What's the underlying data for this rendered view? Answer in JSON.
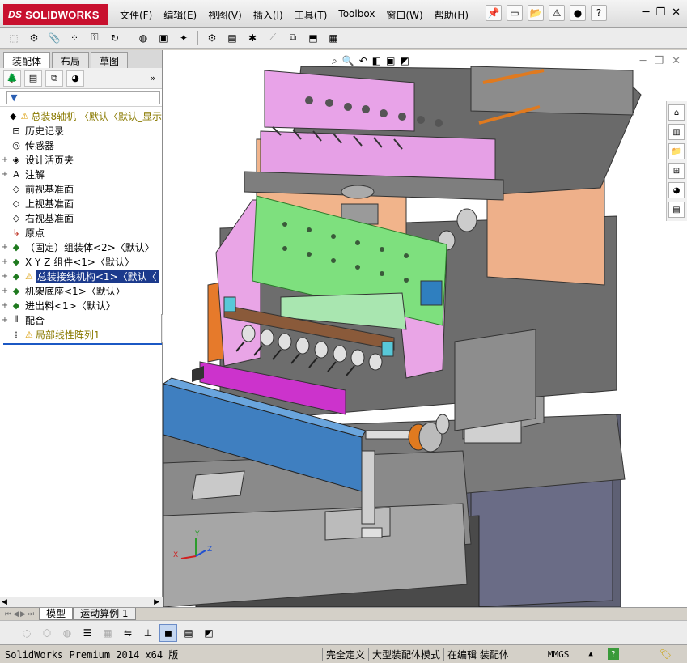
{
  "app": {
    "logo_prefix": "DS",
    "logo_text": "SOLIDWORKS"
  },
  "menu": [
    "文件(F)",
    "编辑(E)",
    "视图(V)",
    "插入(I)",
    "工具(T)",
    "Toolbox",
    "窗口(W)",
    "帮助(H)"
  ],
  "panel": {
    "tabs": [
      "装配体",
      "布局",
      "草图"
    ],
    "active_tab": "装配体",
    "filter_icon": "funnel-icon"
  },
  "tree": [
    {
      "label": "总装8轴机  〈默认〈默认_显示",
      "icon": "assembly-icon",
      "warn": true,
      "style": "olive",
      "expander": ""
    },
    {
      "label": "历史记录",
      "icon": "history-icon",
      "warn": false,
      "style": "",
      "expander": ""
    },
    {
      "label": "传感器",
      "icon": "sensor-icon",
      "warn": false,
      "style": "",
      "expander": ""
    },
    {
      "label": "设计活页夹",
      "icon": "binder-icon",
      "warn": false,
      "style": "",
      "expander": "+"
    },
    {
      "label": "注解",
      "icon": "annotation-icon",
      "warn": false,
      "style": "",
      "expander": "+"
    },
    {
      "label": "前视基准面",
      "icon": "plane-icon",
      "warn": false,
      "style": "",
      "expander": ""
    },
    {
      "label": "上视基准面",
      "icon": "plane-icon",
      "warn": false,
      "style": "",
      "expander": ""
    },
    {
      "label": "右视基准面",
      "icon": "plane-icon",
      "warn": false,
      "style": "",
      "expander": ""
    },
    {
      "label": "原点",
      "icon": "origin-icon",
      "warn": false,
      "style": "",
      "expander": ""
    },
    {
      "label": "（固定）组装体<2>〈默认〉",
      "icon": "subassembly-icon",
      "warn": false,
      "style": "",
      "expander": "+"
    },
    {
      "label": "X Y Z 组件<1>〈默认〉",
      "icon": "subassembly-icon",
      "warn": false,
      "style": "",
      "expander": "+"
    },
    {
      "label": "总装接线机构<1>〈默认〈",
      "icon": "subassembly-icon",
      "warn": true,
      "style": "sel",
      "expander": "+"
    },
    {
      "label": "机架底座<1>〈默认〉",
      "icon": "subassembly-icon",
      "warn": false,
      "style": "",
      "expander": "+"
    },
    {
      "label": "进出料<1>〈默认〉",
      "icon": "subassembly-icon",
      "warn": false,
      "style": "",
      "expander": "+"
    },
    {
      "label": "配合",
      "icon": "mates-icon",
      "warn": false,
      "style": "",
      "expander": "+"
    },
    {
      "label": "局部线性阵列1",
      "icon": "pattern-icon",
      "warn": true,
      "style": "olive",
      "expander": ""
    }
  ],
  "bottom_tabs": [
    "模型",
    "运动算例 1"
  ],
  "status": {
    "product": "SolidWorks Premium 2014 x64 版",
    "definition": "完全定义",
    "mode": "大型装配体模式",
    "editing": "在编辑 装配体",
    "units": "MMGS",
    "help": "?"
  },
  "axes": {
    "x": "X",
    "y": "Y",
    "z": "Z"
  },
  "colors": {
    "brand": "#c8102e",
    "selection": "#1b3a8c",
    "tree_warning": "#8a7a00"
  }
}
